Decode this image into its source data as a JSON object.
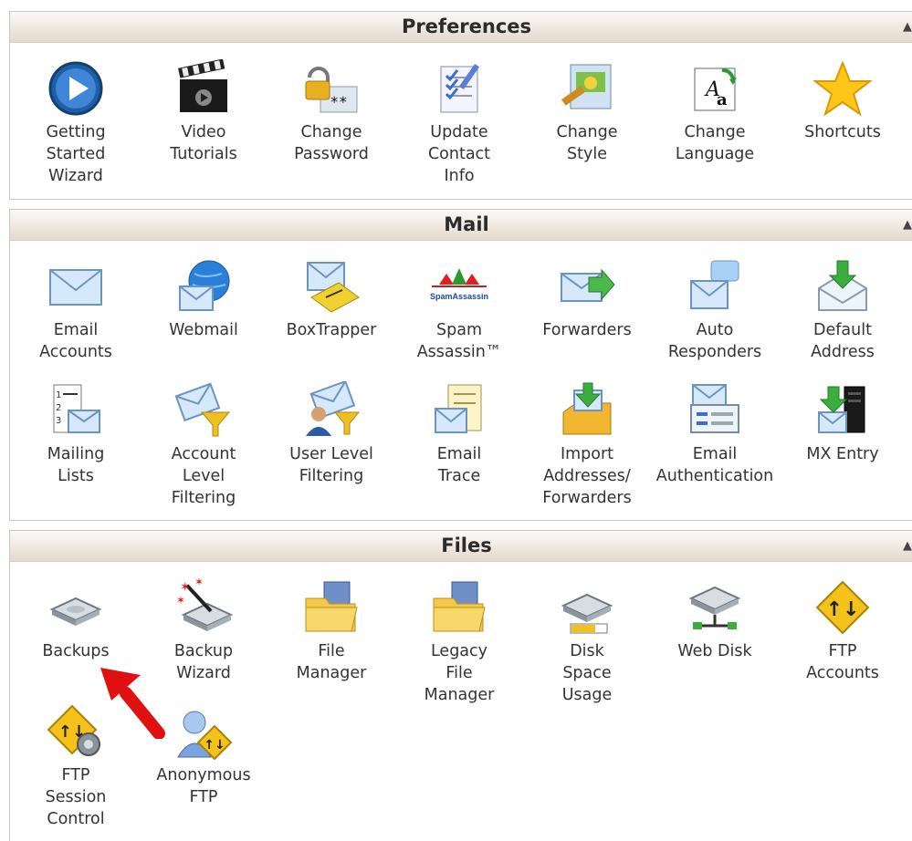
{
  "sections": {
    "preferences": {
      "title": "Preferences",
      "items": [
        {
          "icon": "getting-started-wizard-icon",
          "lines": [
            "Getting",
            "Started",
            "Wizard"
          ]
        },
        {
          "icon": "video-tutorials-icon",
          "lines": [
            "Video",
            "Tutorials"
          ]
        },
        {
          "icon": "change-password-icon",
          "lines": [
            "Change",
            "Password"
          ]
        },
        {
          "icon": "update-contact-info-icon",
          "lines": [
            "Update",
            "Contact",
            "Info"
          ]
        },
        {
          "icon": "change-style-icon",
          "lines": [
            "Change",
            "Style"
          ]
        },
        {
          "icon": "change-language-icon",
          "lines": [
            "Change",
            "Language"
          ]
        },
        {
          "icon": "shortcuts-icon",
          "lines": [
            "Shortcuts"
          ]
        }
      ]
    },
    "mail": {
      "title": "Mail",
      "items": [
        {
          "icon": "email-accounts-icon",
          "lines": [
            "Email",
            "Accounts"
          ]
        },
        {
          "icon": "webmail-icon",
          "lines": [
            "Webmail"
          ]
        },
        {
          "icon": "boxtrapper-icon",
          "lines": [
            "BoxTrapper"
          ]
        },
        {
          "icon": "spam-assassin-icon",
          "lines": [
            "Spam",
            "Assassin™"
          ],
          "logo_text": "SpamAssassin"
        },
        {
          "icon": "forwarders-icon",
          "lines": [
            "Forwarders"
          ]
        },
        {
          "icon": "auto-responders-icon",
          "lines": [
            "Auto",
            "Responders"
          ]
        },
        {
          "icon": "default-address-icon",
          "lines": [
            "Default",
            "Address"
          ]
        },
        {
          "icon": "mailing-lists-icon",
          "lines": [
            "Mailing",
            "Lists"
          ]
        },
        {
          "icon": "account-level-filtering-icon",
          "lines": [
            "Account",
            "Level",
            "Filtering"
          ]
        },
        {
          "icon": "user-level-filtering-icon",
          "lines": [
            "User Level",
            "Filtering"
          ]
        },
        {
          "icon": "email-trace-icon",
          "lines": [
            "Email",
            "Trace"
          ]
        },
        {
          "icon": "import-addresses-forwarders-icon",
          "lines": [
            "Import",
            "Addresses/",
            "Forwarders"
          ]
        },
        {
          "icon": "email-authentication-icon",
          "lines": [
            "Email",
            "Authentication"
          ]
        },
        {
          "icon": "mx-entry-icon",
          "lines": [
            "MX Entry"
          ]
        }
      ]
    },
    "files": {
      "title": "Files",
      "items": [
        {
          "icon": "backups-icon",
          "lines": [
            "Backups"
          ]
        },
        {
          "icon": "backup-wizard-icon",
          "lines": [
            "Backup",
            "Wizard"
          ]
        },
        {
          "icon": "file-manager-icon",
          "lines": [
            "File",
            "Manager"
          ]
        },
        {
          "icon": "legacy-file-manager-icon",
          "lines": [
            "Legacy",
            "File",
            "Manager"
          ]
        },
        {
          "icon": "disk-space-usage-icon",
          "lines": [
            "Disk",
            "Space",
            "Usage"
          ]
        },
        {
          "icon": "web-disk-icon",
          "lines": [
            "Web Disk"
          ]
        },
        {
          "icon": "ftp-accounts-icon",
          "lines": [
            "FTP",
            "Accounts"
          ]
        },
        {
          "icon": "ftp-session-control-icon",
          "lines": [
            "FTP",
            "Session",
            "Control"
          ]
        },
        {
          "icon": "anonymous-ftp-icon",
          "lines": [
            "Anonymous",
            "FTP"
          ]
        }
      ]
    }
  },
  "collapse_glyph": "▲",
  "colors": {
    "annotation_arrow": "#e01010"
  }
}
